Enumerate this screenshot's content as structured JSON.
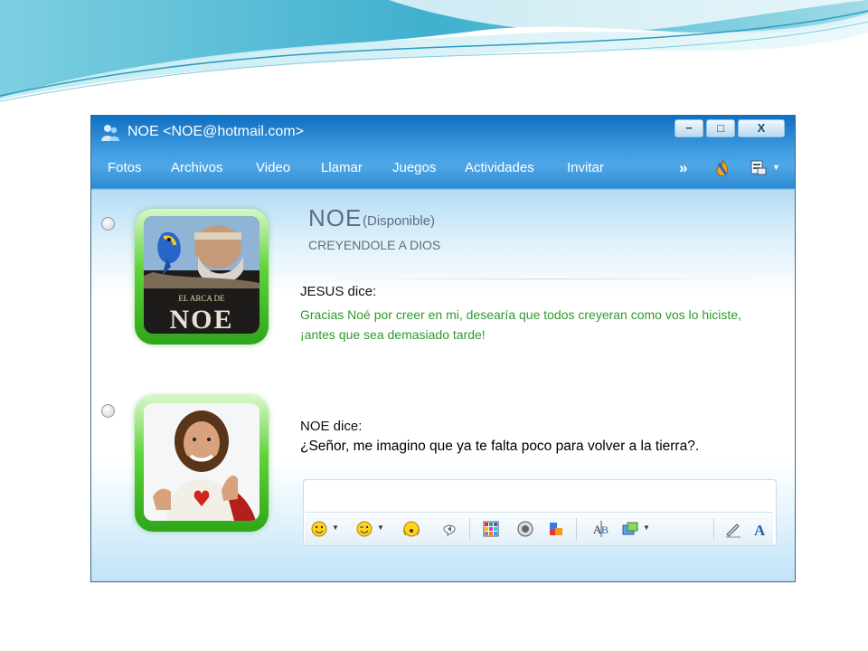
{
  "window": {
    "title": "NOE <NOE@hotmail.com>",
    "controls": {
      "minimize": "−",
      "maximize": "□",
      "close": "X"
    }
  },
  "menu": {
    "items": [
      "Fotos",
      "Archivos",
      "Video",
      "Llamar",
      "Juegos",
      "Actividades",
      "Invitar"
    ],
    "more": "»"
  },
  "contact": {
    "name": "NOE",
    "status": "(Disponible)",
    "personal_message": "CREYENDOLE A DIOS",
    "avatar_caption_1": "EL ARCA DE",
    "avatar_caption_2": "NOE"
  },
  "conversation": [
    {
      "sender": "JESUS dice:",
      "text": "Gracias Noé por creer en mi, desearía que todos creyeran como vos lo hiciste, ¡antes que sea demasiado tarde!"
    },
    {
      "sender": "NOE dice:",
      "text": "¿Señor, me imagino que ya te falta poco para volver a la tierra?."
    }
  ],
  "colors": {
    "accent": "#2e8ad4",
    "green_text": "#2e9a2e",
    "frame_green": "#3fc22a"
  },
  "toolbar_icons": [
    "emoticon-icon",
    "wink-icon",
    "animated-emoticon-icon",
    "nudge-icon",
    "background-icon",
    "voice-clip-icon",
    "game-icon",
    "font-icon",
    "send-file-icon",
    "handwriting-icon",
    "font-style-icon"
  ]
}
